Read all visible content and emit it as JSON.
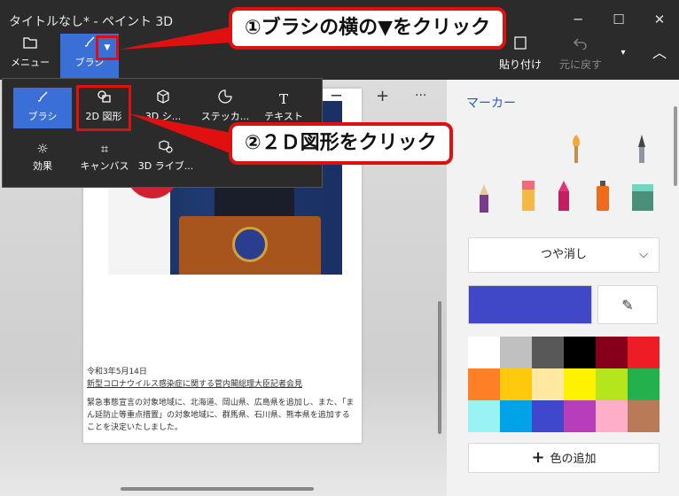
{
  "window": {
    "title": "タイトルなし* - ペイント 3D",
    "min_icon": "─",
    "max_icon": "☐",
    "close_icon": "✕"
  },
  "ribbon": {
    "menu_label": "メニュー",
    "brush_label": "ブラシ",
    "dropdown_icon": "▼",
    "paste_label": "貼り付け",
    "undo_label": "元に戻す",
    "more_icon": "▾",
    "collapse_icon": "︿"
  },
  "flyout": {
    "items": [
      {
        "label": "ブラシ",
        "icon": "brush-icon"
      },
      {
        "label": "2D 図形",
        "icon": "2d-shapes-icon"
      },
      {
        "label": "3D シ...",
        "icon": "3d-shapes-icon"
      },
      {
        "label": "ステッカ...",
        "icon": "stickers-icon"
      },
      {
        "label": "テキスト",
        "icon": "text-icon"
      },
      {
        "label": "効果",
        "icon": "effects-icon"
      },
      {
        "label": "キャンバス",
        "icon": "canvas-icon"
      },
      {
        "label": "3D ライブ...",
        "icon": "3d-library-icon"
      }
    ]
  },
  "canvas_tools": {
    "minus": "─",
    "plus": "+",
    "more": "···"
  },
  "document": {
    "date": "令和3年5月14日",
    "headline": "新型コロナウイルス感染症に関する菅内閣総理大臣記者会見",
    "body": "緊急事態宣言の対象地域に、北海道、岡山県、広島県を追加し、また、「まん延防止等重点措置」の対象地域に、群馬県、石川県、熊本県を追加することを決定いたしました。"
  },
  "panel": {
    "title": "マーカー",
    "finish": "つや消し",
    "finish_chevron": "⌵",
    "eyedropper_icon": "✎",
    "add_color_icon": "+",
    "add_color": "色の追加",
    "current_color": "#4148c8",
    "swatches": [
      "#ffffff",
      "#c0c0c0",
      "#585858",
      "#000000",
      "#87001b",
      "#ee1c25",
      "#ff7f26",
      "#ffc90e",
      "#ffe8a0",
      "#fff200",
      "#b5e61d",
      "#22b14c",
      "#99f2f3",
      "#00a2e8",
      "#3f48cc",
      "#b83dba",
      "#ffaec9",
      "#b97a57"
    ]
  },
  "callouts": {
    "step1": "①ブラシの横の▼をクリック",
    "step2": "②２Ｄ図形をクリック"
  }
}
